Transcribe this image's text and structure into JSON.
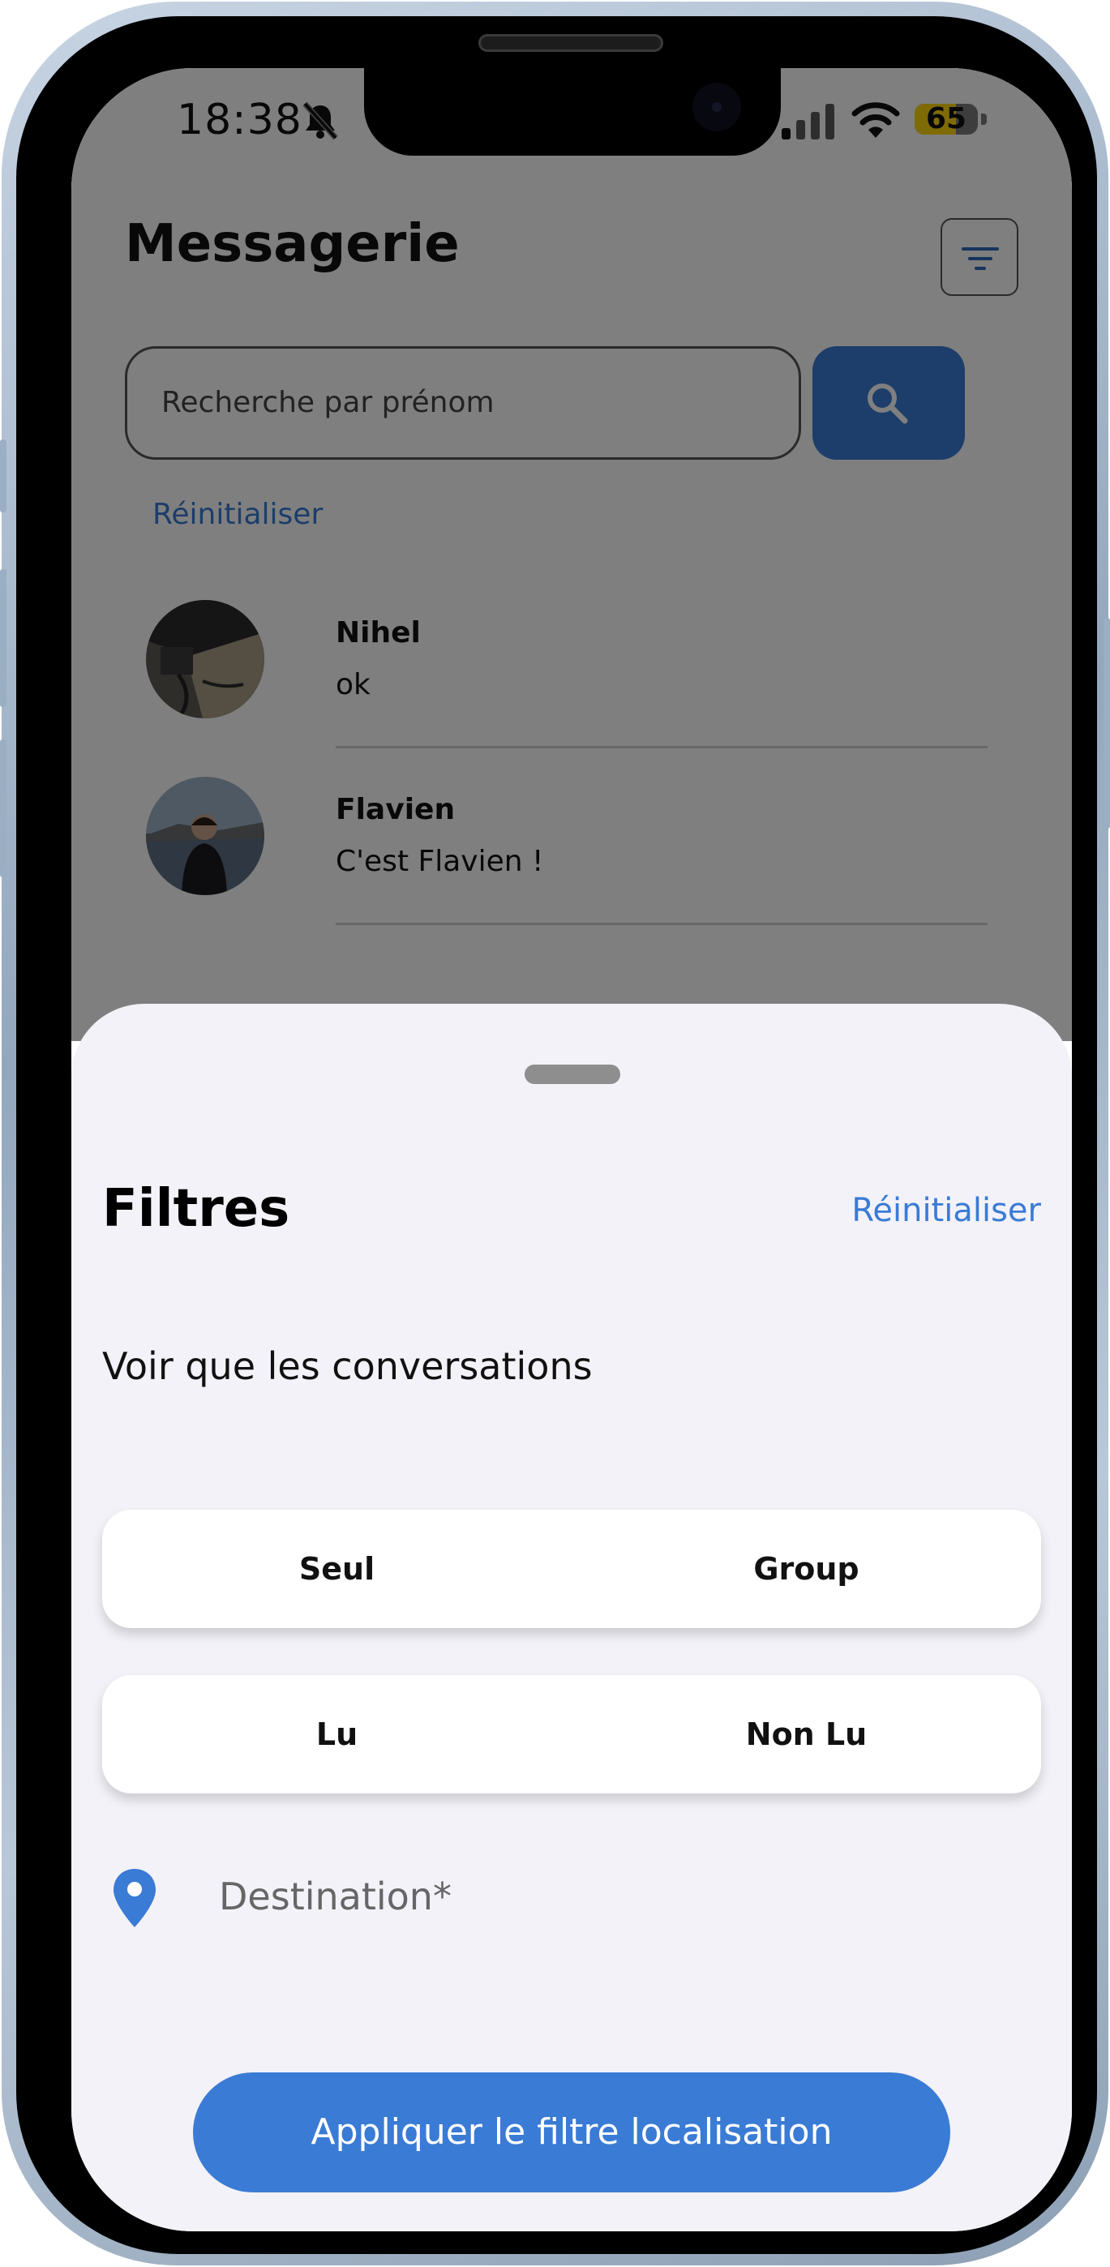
{
  "status_bar": {
    "time": "18:38",
    "battery_level": "65",
    "battery_fraction": 0.65,
    "icons": [
      "bell-slash-icon",
      "cellular-signal-icon",
      "wifi-icon",
      "battery-icon"
    ]
  },
  "header": {
    "title": "Messagerie",
    "filter_icon": "filter-icon"
  },
  "search": {
    "placeholder": "Recherche par prénom",
    "button_icon": "search-icon"
  },
  "reset_link": "Réinitialiser",
  "conversations": [
    {
      "name": "Nihel",
      "last_message": "ok"
    },
    {
      "name": "Flavien",
      "last_message": "C'est Flavien !"
    }
  ],
  "sheet": {
    "title": "Filtres",
    "reset_label": "Réinitialiser",
    "section_label": "Voir que les conversations",
    "type_options": [
      "Seul",
      "Group"
    ],
    "read_options": [
      "Lu",
      "Non Lu"
    ],
    "destination_placeholder": "Destination*",
    "location_icon": "map-pin-icon",
    "apply_label": "Appliquer le filtre localisation"
  },
  "colors": {
    "accent": "#3a7bd5",
    "battery": "#ffd60a",
    "sheet_background": "#f3f2f8"
  }
}
